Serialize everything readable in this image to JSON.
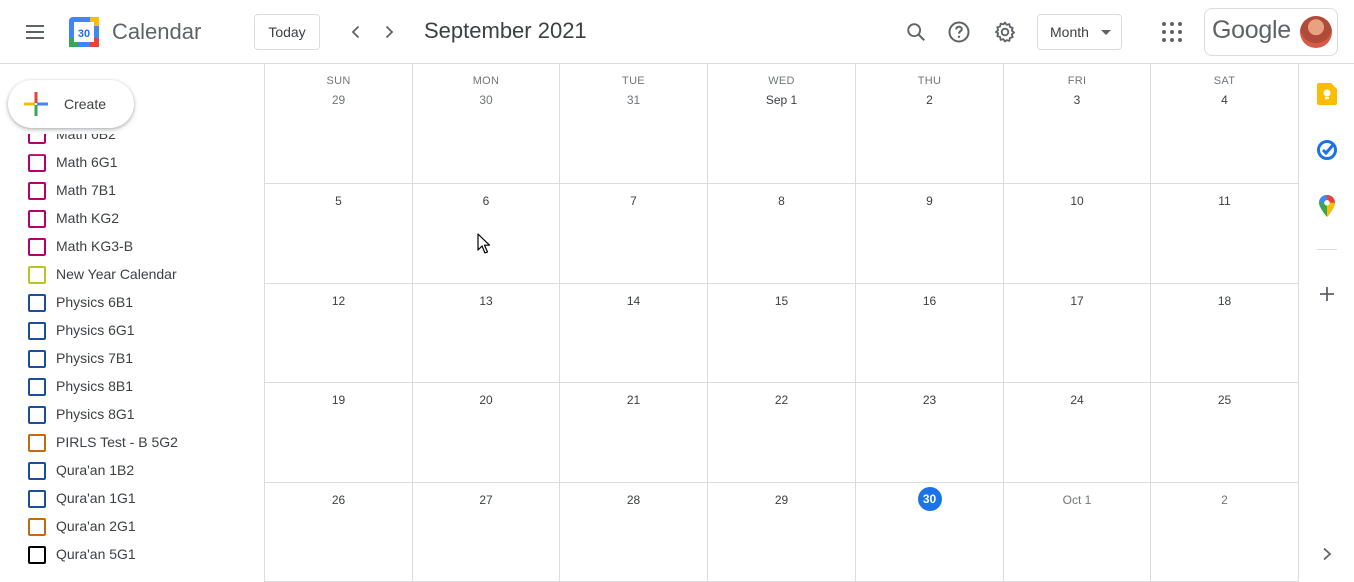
{
  "header": {
    "menu_icon": "hamburger-menu-icon",
    "logo_date": "30",
    "app_title": "Calendar",
    "today_label": "Today",
    "month_title": "September 2021",
    "view_label": "Month",
    "brand_word": "Google"
  },
  "sidebar": {
    "create_label": "Create",
    "calendars": [
      {
        "label": "Math 6B2",
        "color": "#b5006b"
      },
      {
        "label": "Math 6G1",
        "color": "#b5006b"
      },
      {
        "label": "Math 7B1",
        "color": "#b5006b"
      },
      {
        "label": "Math KG2",
        "color": "#b5006b"
      },
      {
        "label": "Math KG3-B",
        "color": "#b5006b"
      },
      {
        "label": "New Year Calendar",
        "color": "#b6c62b"
      },
      {
        "label": "Physics 6B1",
        "color": "#1a4fa0"
      },
      {
        "label": "Physics 6G1",
        "color": "#1a4fa0"
      },
      {
        "label": "Physics 7B1",
        "color": "#1a4fa0"
      },
      {
        "label": "Physics 8B1",
        "color": "#1a4fa0"
      },
      {
        "label": "Physics 8G1",
        "color": "#1a4fa0"
      },
      {
        "label": "PIRLS Test - B 5G2",
        "color": "#c26a11"
      },
      {
        "label": "Qura'an 1B2",
        "color": "#1a4fa0"
      },
      {
        "label": "Qura'an 1G1",
        "color": "#1a4fa0"
      },
      {
        "label": "Qura'an 2G1",
        "color": "#c26a11"
      },
      {
        "label": "Qura'an 5G1",
        "color": "#000000"
      }
    ]
  },
  "month": {
    "weekdays": [
      "SUN",
      "MON",
      "TUE",
      "WED",
      "THU",
      "FRI",
      "SAT"
    ],
    "weeks": [
      [
        "29",
        "30",
        "31",
        "Sep 1",
        "2",
        "3",
        "4"
      ],
      [
        "5",
        "6",
        "7",
        "8",
        "9",
        "10",
        "11"
      ],
      [
        "12",
        "13",
        "14",
        "15",
        "16",
        "17",
        "18"
      ],
      [
        "19",
        "20",
        "21",
        "22",
        "23",
        "24",
        "25"
      ],
      [
        "26",
        "27",
        "28",
        "29",
        "30",
        "Oct 1",
        "2"
      ]
    ],
    "muted": [
      [
        true,
        true,
        true,
        false,
        false,
        false,
        false
      ],
      [],
      [],
      [],
      [
        false,
        false,
        false,
        false,
        false,
        true,
        true
      ]
    ],
    "today": {
      "week": 4,
      "day": 4
    }
  },
  "colors": {
    "accent": "#1a73e8",
    "grid_line": "#dadce0",
    "keep_yellow": "#fbbc04",
    "tasks_blue": "#1a73e8"
  },
  "rail": {
    "icons": [
      "keep-icon",
      "tasks-icon",
      "maps-icon",
      "add-icon",
      "chevron-right-icon"
    ]
  }
}
